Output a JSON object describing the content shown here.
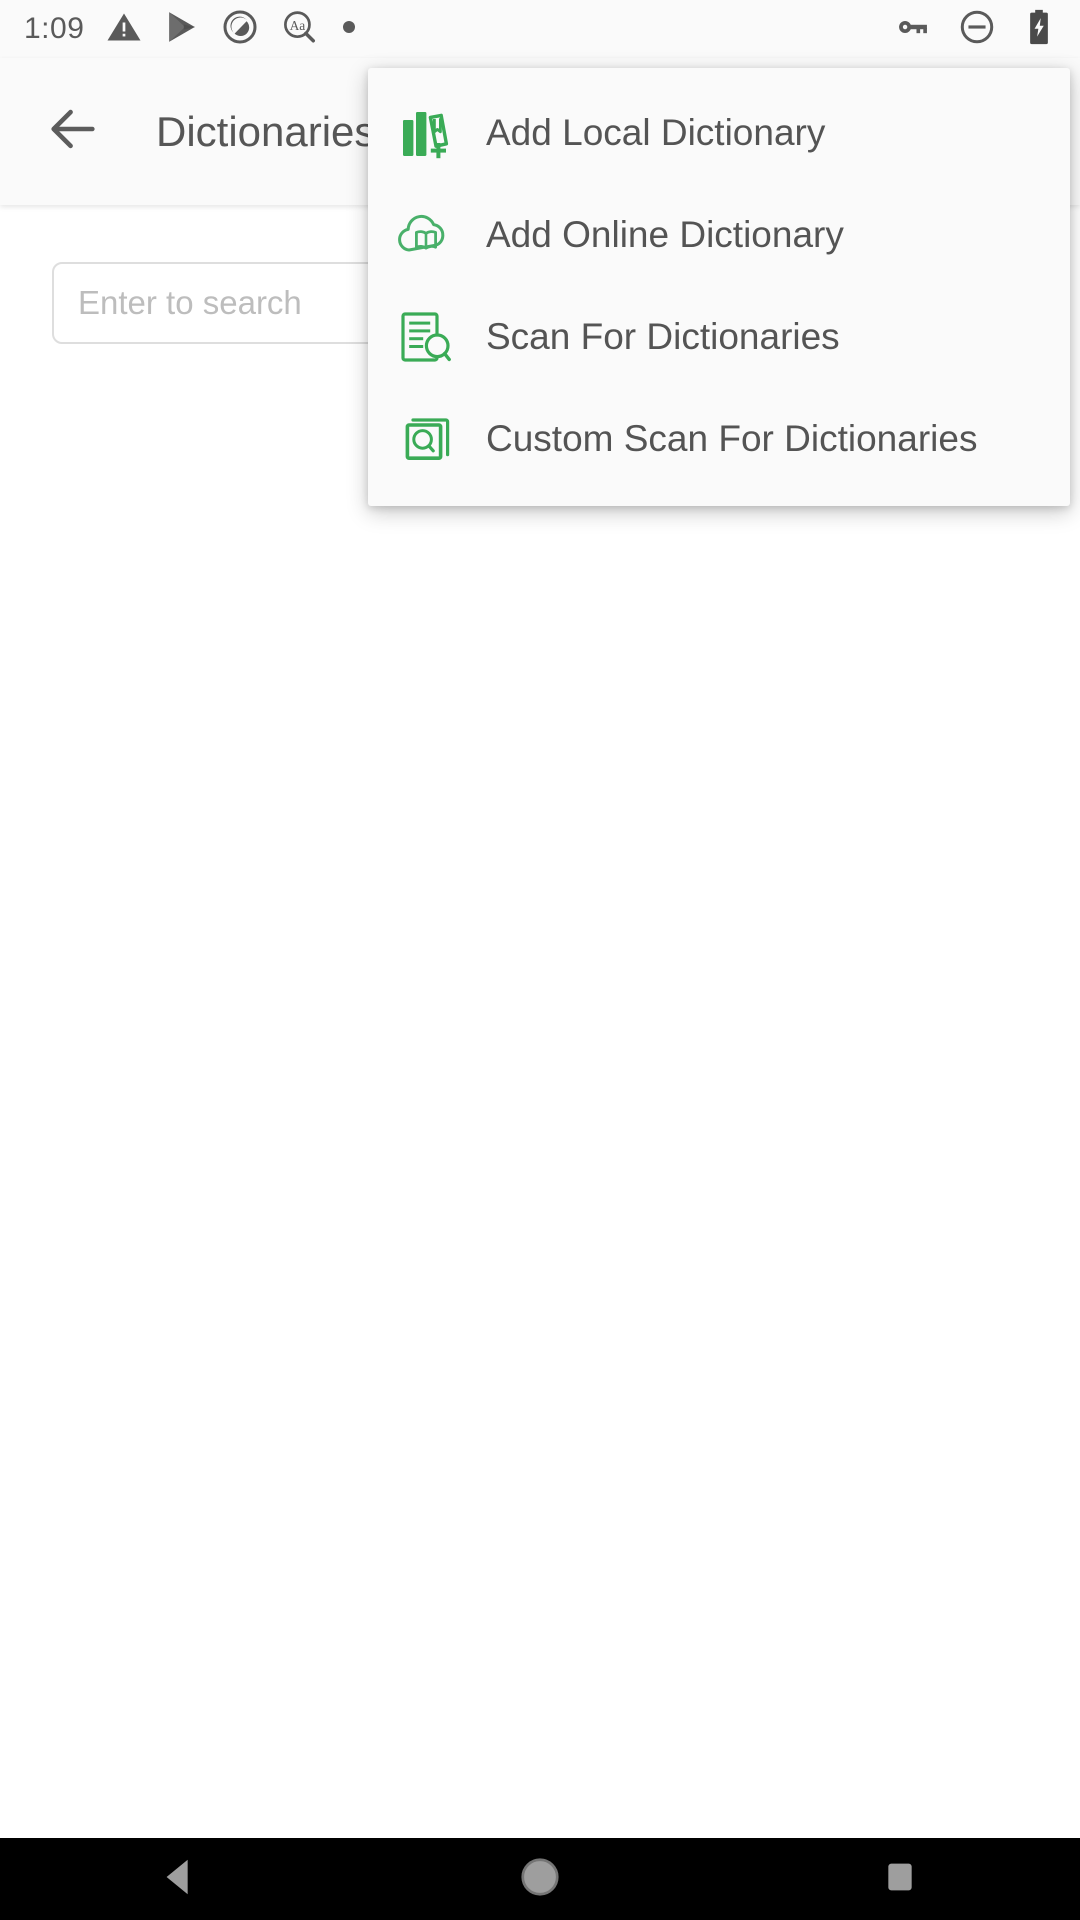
{
  "status_bar": {
    "time": "1:09",
    "left_icons": [
      {
        "name": "warning-triangle-icon",
        "glyph": "warning"
      },
      {
        "name": "play-store-icon",
        "glyph": "play"
      },
      {
        "name": "circle-app-icon",
        "glyph": "circle-slash"
      },
      {
        "name": "text-size-search-icon",
        "glyph": "Aa"
      },
      {
        "name": "notification-dot-icon",
        "glyph": "dot"
      }
    ],
    "right_icons": [
      {
        "name": "vpn-key-icon",
        "glyph": "key"
      },
      {
        "name": "do-not-disturb-icon",
        "glyph": "minus-circle"
      },
      {
        "name": "battery-charging-icon",
        "glyph": "battery-bolt"
      }
    ]
  },
  "app_bar": {
    "back_label": "back-arrow",
    "title": "Dictionaries"
  },
  "search": {
    "value": "",
    "placeholder": "Enter to search"
  },
  "menu": {
    "items": [
      {
        "label": "Add Local Dictionary",
        "icon": "add-local-dictionary-icon"
      },
      {
        "label": "Add Online Dictionary",
        "icon": "add-online-dictionary-icon"
      },
      {
        "label": "Scan For Dictionaries",
        "icon": "scan-for-dictionaries-icon"
      },
      {
        "label": "Custom Scan For Dictionaries",
        "icon": "custom-scan-for-dictionaries-icon"
      }
    ]
  },
  "nav_bar": {
    "back": "back-nav-button",
    "home": "home-nav-button",
    "recents": "recents-nav-button"
  },
  "colors": {
    "accent_green": "#3aab56",
    "status_bar_bg": "#fafafa",
    "app_bar_bg": "#fafafa",
    "menu_bg": "#fafafa",
    "text_primary": "#545454",
    "placeholder": "#bdbdbd",
    "nav_bar_bg": "#000000"
  }
}
